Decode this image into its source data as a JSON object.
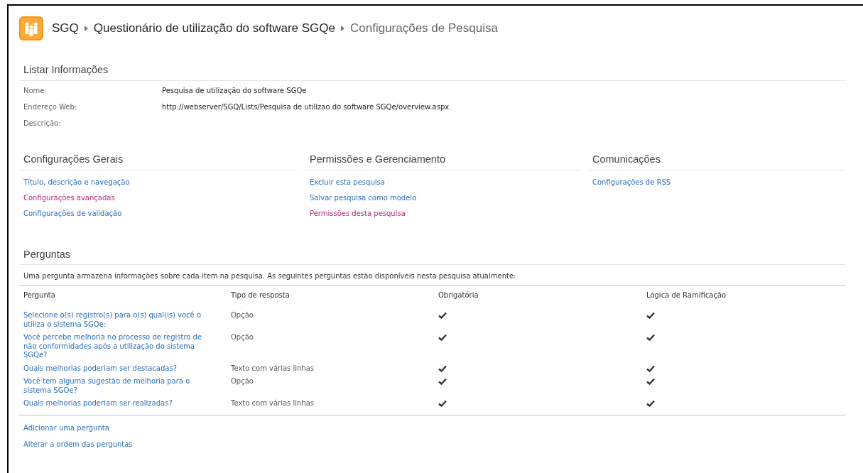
{
  "breadcrumb": [
    "SGQ",
    "Questionário de utilização do software SGQe",
    "Configurações de Pesquisa"
  ],
  "list_info": {
    "title": "Listar Informações",
    "fields": [
      {
        "label": "Nome:",
        "value": "Pesquisa de utilização do software SGQe"
      },
      {
        "label": "Endereço Web:",
        "value": "http://webserver/SGQ/Lists/Pesquisa de utilizao do software SGQe/overview.aspx"
      },
      {
        "label": "Descrição:"
      }
    ]
  },
  "settings_sections": [
    {
      "title": "Configurações Gerais",
      "links": [
        {
          "label": "Título, descrição e navegação",
          "visited": false
        },
        {
          "label": "Configurações avançadas",
          "visited": true
        },
        {
          "label": "Configurações de validação",
          "visited": false
        }
      ]
    },
    {
      "title": "Permissões e Gerenciamento",
      "links": [
        {
          "label": "Excluir esta pesquisa",
          "visited": false
        },
        {
          "label": "Salvar pesquisa como modelo",
          "visited": false
        },
        {
          "label": "Permissões desta pesquisa",
          "visited": true
        }
      ]
    },
    {
      "title": "Comunicações",
      "links": [
        {
          "label": "Configurações de RSS",
          "visited": false
        }
      ]
    }
  ],
  "questions": {
    "title": "Perguntas",
    "description": "Uma pergunta armazena informações sobre cada item na pesquisa. As seguintes perguntas estão disponíveis nesta pesquisa atualmente:",
    "columns": [
      "Pergunta",
      "Tipo de resposta",
      "Obrigatória",
      "Lógica de Ramificação"
    ],
    "rows": [
      {
        "question": "Selecione o(s) registro(s) para o(s) qual(is) você o utiliza o sistema SGQe:",
        "type": "Opção",
        "required": true,
        "branching": true
      },
      {
        "question": "Você percebe melhoria no processo de registro de não conformidades após a utilização do sistema SGQe?",
        "type": "Opção",
        "required": true,
        "branching": true
      },
      {
        "question": "Quais melhorias poderiam ser destacadas?",
        "type": "Texto com várias linhas",
        "required": true,
        "branching": true
      },
      {
        "question": "Você tem alguma sugestão de melhoria para o sistema SGQe?",
        "type": "Opção",
        "required": true,
        "branching": true
      },
      {
        "question": "Quais melhorias poderiam ser realizadas?",
        "type": "Texto com várias linhas",
        "required": true,
        "branching": true
      }
    ],
    "links": [
      "Adicionar uma pergunta",
      "Alterar a ordem das perguntas"
    ]
  }
}
